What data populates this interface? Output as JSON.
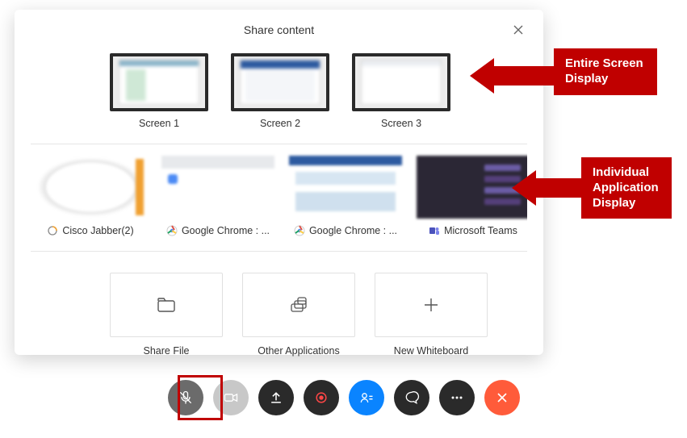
{
  "panel": {
    "title": "Share content"
  },
  "screens": [
    {
      "label": "Screen 1"
    },
    {
      "label": "Screen 2"
    },
    {
      "label": "Screen 3"
    }
  ],
  "apps": [
    {
      "label": "Cisco Jabber(2)",
      "icon": "jabber"
    },
    {
      "label": "Google Chrome : ...",
      "icon": "chrome"
    },
    {
      "label": "Google Chrome : ...",
      "icon": "chrome"
    },
    {
      "label": "Microsoft Teams",
      "icon": "teams"
    }
  ],
  "options": {
    "share_file": "Share File",
    "other_apps": "Other Applications",
    "new_whiteboard": "New Whiteboard"
  },
  "callouts": {
    "screens": "Entire Screen Display",
    "apps": "Individual Application Display"
  },
  "toolbar": {
    "mute": "Mute",
    "video": "Video",
    "share": "Share",
    "record": "Record",
    "participants": "Participants",
    "chat": "Chat",
    "more": "More options",
    "end": "End call"
  }
}
